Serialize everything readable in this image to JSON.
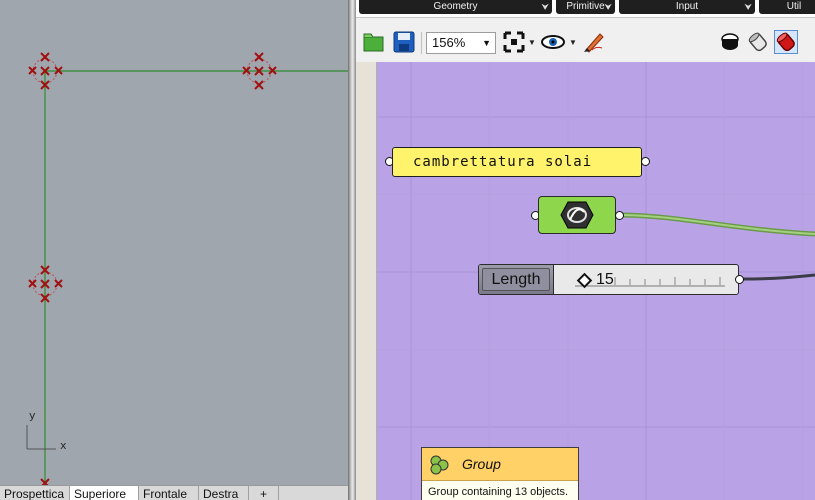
{
  "viewport": {
    "axis_y": "y",
    "axis_x": "x",
    "tabs": [
      {
        "label": "Prospettica",
        "active": false
      },
      {
        "label": "Superiore",
        "active": true
      },
      {
        "label": "Frontale",
        "active": false
      },
      {
        "label": "Destra",
        "active": false
      },
      {
        "label": "+",
        "active": false
      }
    ]
  },
  "ribbon": {
    "tabs": [
      "Geometry",
      "Primitive",
      "Input",
      "Util"
    ]
  },
  "toolbar": {
    "zoom": "156%",
    "icons": [
      "open-file-icon",
      "save-file-icon",
      "zoom-extents-icon",
      "preview-eye-icon",
      "sketch-pen-icon",
      "preview-wireframe-icon",
      "preview-shaded-icon",
      "preview-selected-icon"
    ]
  },
  "canvas": {
    "panel_text": "cambrettatura solai",
    "slider_name": "Length",
    "slider_value": "15",
    "group_tooltip": {
      "title": "Group",
      "description": "Group containing 13 objects."
    }
  },
  "colors": {
    "canvas": "#b9a3e6",
    "viewport": "#a0a6ae",
    "panel": "#fff36b",
    "param": "#8ed64c",
    "curve": "#2e8b2e",
    "point_marker": "#a01010"
  }
}
